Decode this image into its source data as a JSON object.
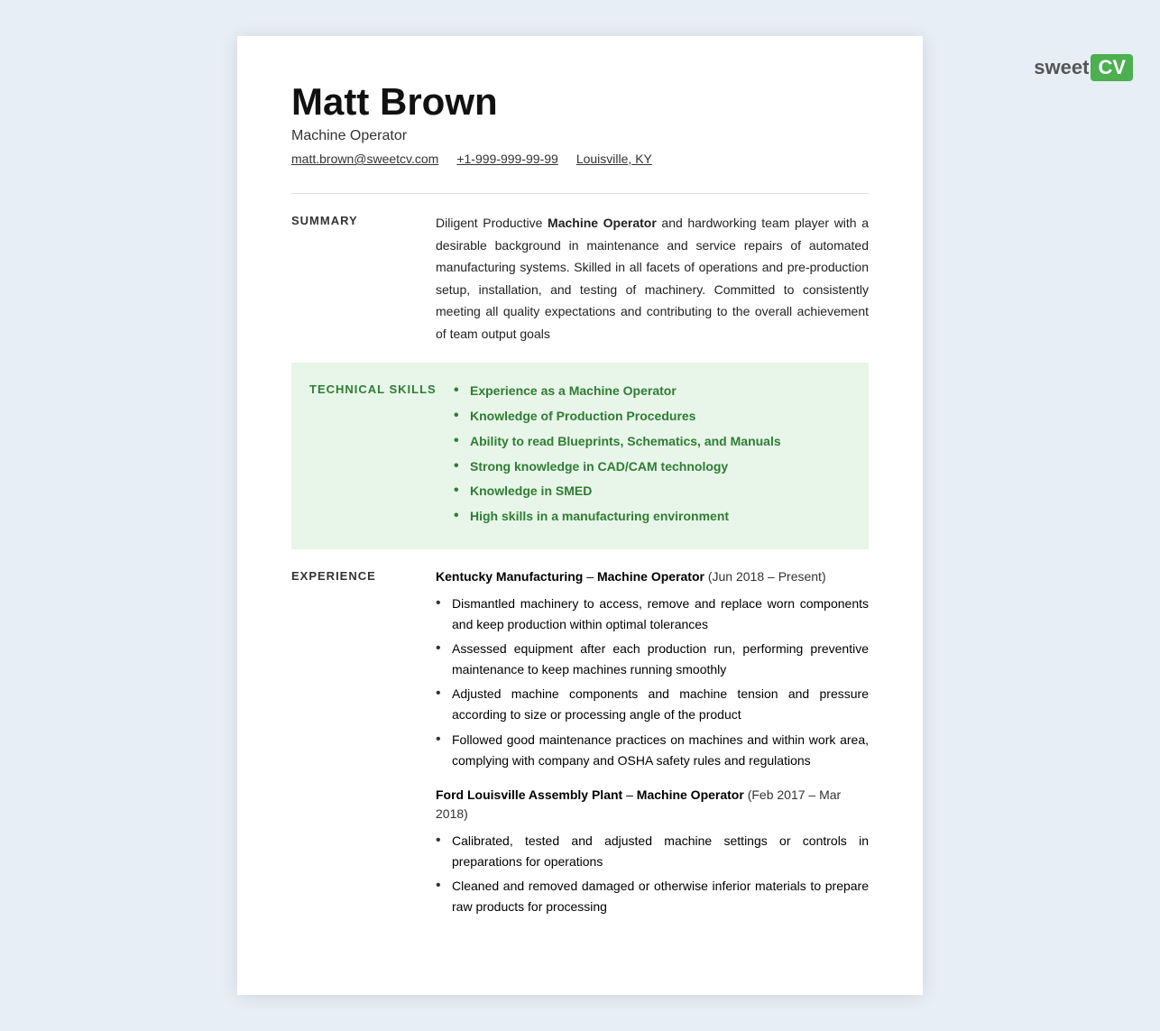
{
  "logo": {
    "sweet": "sweet",
    "cv": "CV"
  },
  "header": {
    "name": "Matt Brown",
    "title": "Machine Operator",
    "email": "matt.brown@sweetcv.com",
    "phone": "+1-999-999-99-99",
    "location": "Louisville, KY"
  },
  "sections": {
    "summary": {
      "label": "SUMMARY",
      "text_normal_before": "Diligent Productive ",
      "text_bold": "Machine Operator",
      "text_normal_after": " and hardworking team player with a desirable background in maintenance and service repairs of automated manufacturing systems. Skilled in all facets of operations and pre-production setup, installation, and testing of machinery. Committed to consistently meeting all quality expectations and contributing to the overall achievement of team output goals"
    },
    "technical_skills": {
      "label": "TECHNICAL SKILLS",
      "skills": [
        "Experience as a Machine Operator",
        "Knowledge of Production Procedures",
        "Ability to read Blueprints, Schematics, and Manuals",
        "Strong knowledge in CAD/CAM technology",
        "Knowledge in SMED",
        "High skills in a manufacturing environment"
      ]
    },
    "experience": {
      "label": "EXPERIENCE",
      "jobs": [
        {
          "company": "Kentucky Manufacturing",
          "separator": " – ",
          "role": "Machine Operator",
          "dates": " (Jun 2018 – Present)",
          "bullets": [
            "Dismantled machinery to access, remove and replace worn components and keep production within optimal tolerances",
            "Assessed equipment after each production run, performing preventive maintenance to keep machines running smoothly",
            "Adjusted machine components and machine tension and pressure according to size or processing angle of the product",
            "Followed good maintenance practices on machines and within work area, complying with company and OSHA safety rules and regulations"
          ]
        },
        {
          "company": "Ford Louisville Assembly Plant",
          "separator": " – ",
          "role": "Machine Operator",
          "dates": " (Feb 2017 – Mar 2018)",
          "bullets": [
            "Calibrated, tested and adjusted machine settings or controls in preparations for operations",
            "Cleaned and removed damaged or otherwise inferior materials to prepare raw products for processing"
          ]
        }
      ]
    }
  }
}
